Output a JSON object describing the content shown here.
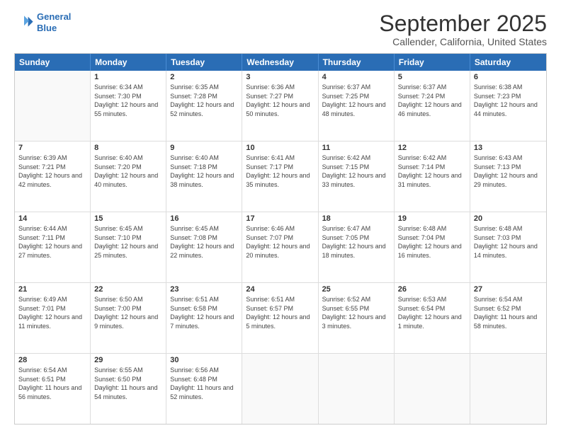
{
  "logo": {
    "line1": "General",
    "line2": "Blue"
  },
  "title": "September 2025",
  "location": "Callender, California, United States",
  "header_days": [
    "Sunday",
    "Monday",
    "Tuesday",
    "Wednesday",
    "Thursday",
    "Friday",
    "Saturday"
  ],
  "rows": [
    [
      {
        "day": "",
        "sunrise": "",
        "sunset": "",
        "daylight": ""
      },
      {
        "day": "1",
        "sunrise": "Sunrise: 6:34 AM",
        "sunset": "Sunset: 7:30 PM",
        "daylight": "Daylight: 12 hours and 55 minutes."
      },
      {
        "day": "2",
        "sunrise": "Sunrise: 6:35 AM",
        "sunset": "Sunset: 7:28 PM",
        "daylight": "Daylight: 12 hours and 52 minutes."
      },
      {
        "day": "3",
        "sunrise": "Sunrise: 6:36 AM",
        "sunset": "Sunset: 7:27 PM",
        "daylight": "Daylight: 12 hours and 50 minutes."
      },
      {
        "day": "4",
        "sunrise": "Sunrise: 6:37 AM",
        "sunset": "Sunset: 7:25 PM",
        "daylight": "Daylight: 12 hours and 48 minutes."
      },
      {
        "day": "5",
        "sunrise": "Sunrise: 6:37 AM",
        "sunset": "Sunset: 7:24 PM",
        "daylight": "Daylight: 12 hours and 46 minutes."
      },
      {
        "day": "6",
        "sunrise": "Sunrise: 6:38 AM",
        "sunset": "Sunset: 7:23 PM",
        "daylight": "Daylight: 12 hours and 44 minutes."
      }
    ],
    [
      {
        "day": "7",
        "sunrise": "Sunrise: 6:39 AM",
        "sunset": "Sunset: 7:21 PM",
        "daylight": "Daylight: 12 hours and 42 minutes."
      },
      {
        "day": "8",
        "sunrise": "Sunrise: 6:40 AM",
        "sunset": "Sunset: 7:20 PM",
        "daylight": "Daylight: 12 hours and 40 minutes."
      },
      {
        "day": "9",
        "sunrise": "Sunrise: 6:40 AM",
        "sunset": "Sunset: 7:18 PM",
        "daylight": "Daylight: 12 hours and 38 minutes."
      },
      {
        "day": "10",
        "sunrise": "Sunrise: 6:41 AM",
        "sunset": "Sunset: 7:17 PM",
        "daylight": "Daylight: 12 hours and 35 minutes."
      },
      {
        "day": "11",
        "sunrise": "Sunrise: 6:42 AM",
        "sunset": "Sunset: 7:15 PM",
        "daylight": "Daylight: 12 hours and 33 minutes."
      },
      {
        "day": "12",
        "sunrise": "Sunrise: 6:42 AM",
        "sunset": "Sunset: 7:14 PM",
        "daylight": "Daylight: 12 hours and 31 minutes."
      },
      {
        "day": "13",
        "sunrise": "Sunrise: 6:43 AM",
        "sunset": "Sunset: 7:13 PM",
        "daylight": "Daylight: 12 hours and 29 minutes."
      }
    ],
    [
      {
        "day": "14",
        "sunrise": "Sunrise: 6:44 AM",
        "sunset": "Sunset: 7:11 PM",
        "daylight": "Daylight: 12 hours and 27 minutes."
      },
      {
        "day": "15",
        "sunrise": "Sunrise: 6:45 AM",
        "sunset": "Sunset: 7:10 PM",
        "daylight": "Daylight: 12 hours and 25 minutes."
      },
      {
        "day": "16",
        "sunrise": "Sunrise: 6:45 AM",
        "sunset": "Sunset: 7:08 PM",
        "daylight": "Daylight: 12 hours and 22 minutes."
      },
      {
        "day": "17",
        "sunrise": "Sunrise: 6:46 AM",
        "sunset": "Sunset: 7:07 PM",
        "daylight": "Daylight: 12 hours and 20 minutes."
      },
      {
        "day": "18",
        "sunrise": "Sunrise: 6:47 AM",
        "sunset": "Sunset: 7:05 PM",
        "daylight": "Daylight: 12 hours and 18 minutes."
      },
      {
        "day": "19",
        "sunrise": "Sunrise: 6:48 AM",
        "sunset": "Sunset: 7:04 PM",
        "daylight": "Daylight: 12 hours and 16 minutes."
      },
      {
        "day": "20",
        "sunrise": "Sunrise: 6:48 AM",
        "sunset": "Sunset: 7:03 PM",
        "daylight": "Daylight: 12 hours and 14 minutes."
      }
    ],
    [
      {
        "day": "21",
        "sunrise": "Sunrise: 6:49 AM",
        "sunset": "Sunset: 7:01 PM",
        "daylight": "Daylight: 12 hours and 11 minutes."
      },
      {
        "day": "22",
        "sunrise": "Sunrise: 6:50 AM",
        "sunset": "Sunset: 7:00 PM",
        "daylight": "Daylight: 12 hours and 9 minutes."
      },
      {
        "day": "23",
        "sunrise": "Sunrise: 6:51 AM",
        "sunset": "Sunset: 6:58 PM",
        "daylight": "Daylight: 12 hours and 7 minutes."
      },
      {
        "day": "24",
        "sunrise": "Sunrise: 6:51 AM",
        "sunset": "Sunset: 6:57 PM",
        "daylight": "Daylight: 12 hours and 5 minutes."
      },
      {
        "day": "25",
        "sunrise": "Sunrise: 6:52 AM",
        "sunset": "Sunset: 6:55 PM",
        "daylight": "Daylight: 12 hours and 3 minutes."
      },
      {
        "day": "26",
        "sunrise": "Sunrise: 6:53 AM",
        "sunset": "Sunset: 6:54 PM",
        "daylight": "Daylight: 12 hours and 1 minute."
      },
      {
        "day": "27",
        "sunrise": "Sunrise: 6:54 AM",
        "sunset": "Sunset: 6:52 PM",
        "daylight": "Daylight: 11 hours and 58 minutes."
      }
    ],
    [
      {
        "day": "28",
        "sunrise": "Sunrise: 6:54 AM",
        "sunset": "Sunset: 6:51 PM",
        "daylight": "Daylight: 11 hours and 56 minutes."
      },
      {
        "day": "29",
        "sunrise": "Sunrise: 6:55 AM",
        "sunset": "Sunset: 6:50 PM",
        "daylight": "Daylight: 11 hours and 54 minutes."
      },
      {
        "day": "30",
        "sunrise": "Sunrise: 6:56 AM",
        "sunset": "Sunset: 6:48 PM",
        "daylight": "Daylight: 11 hours and 52 minutes."
      },
      {
        "day": "",
        "sunrise": "",
        "sunset": "",
        "daylight": ""
      },
      {
        "day": "",
        "sunrise": "",
        "sunset": "",
        "daylight": ""
      },
      {
        "day": "",
        "sunrise": "",
        "sunset": "",
        "daylight": ""
      },
      {
        "day": "",
        "sunrise": "",
        "sunset": "",
        "daylight": ""
      }
    ]
  ]
}
